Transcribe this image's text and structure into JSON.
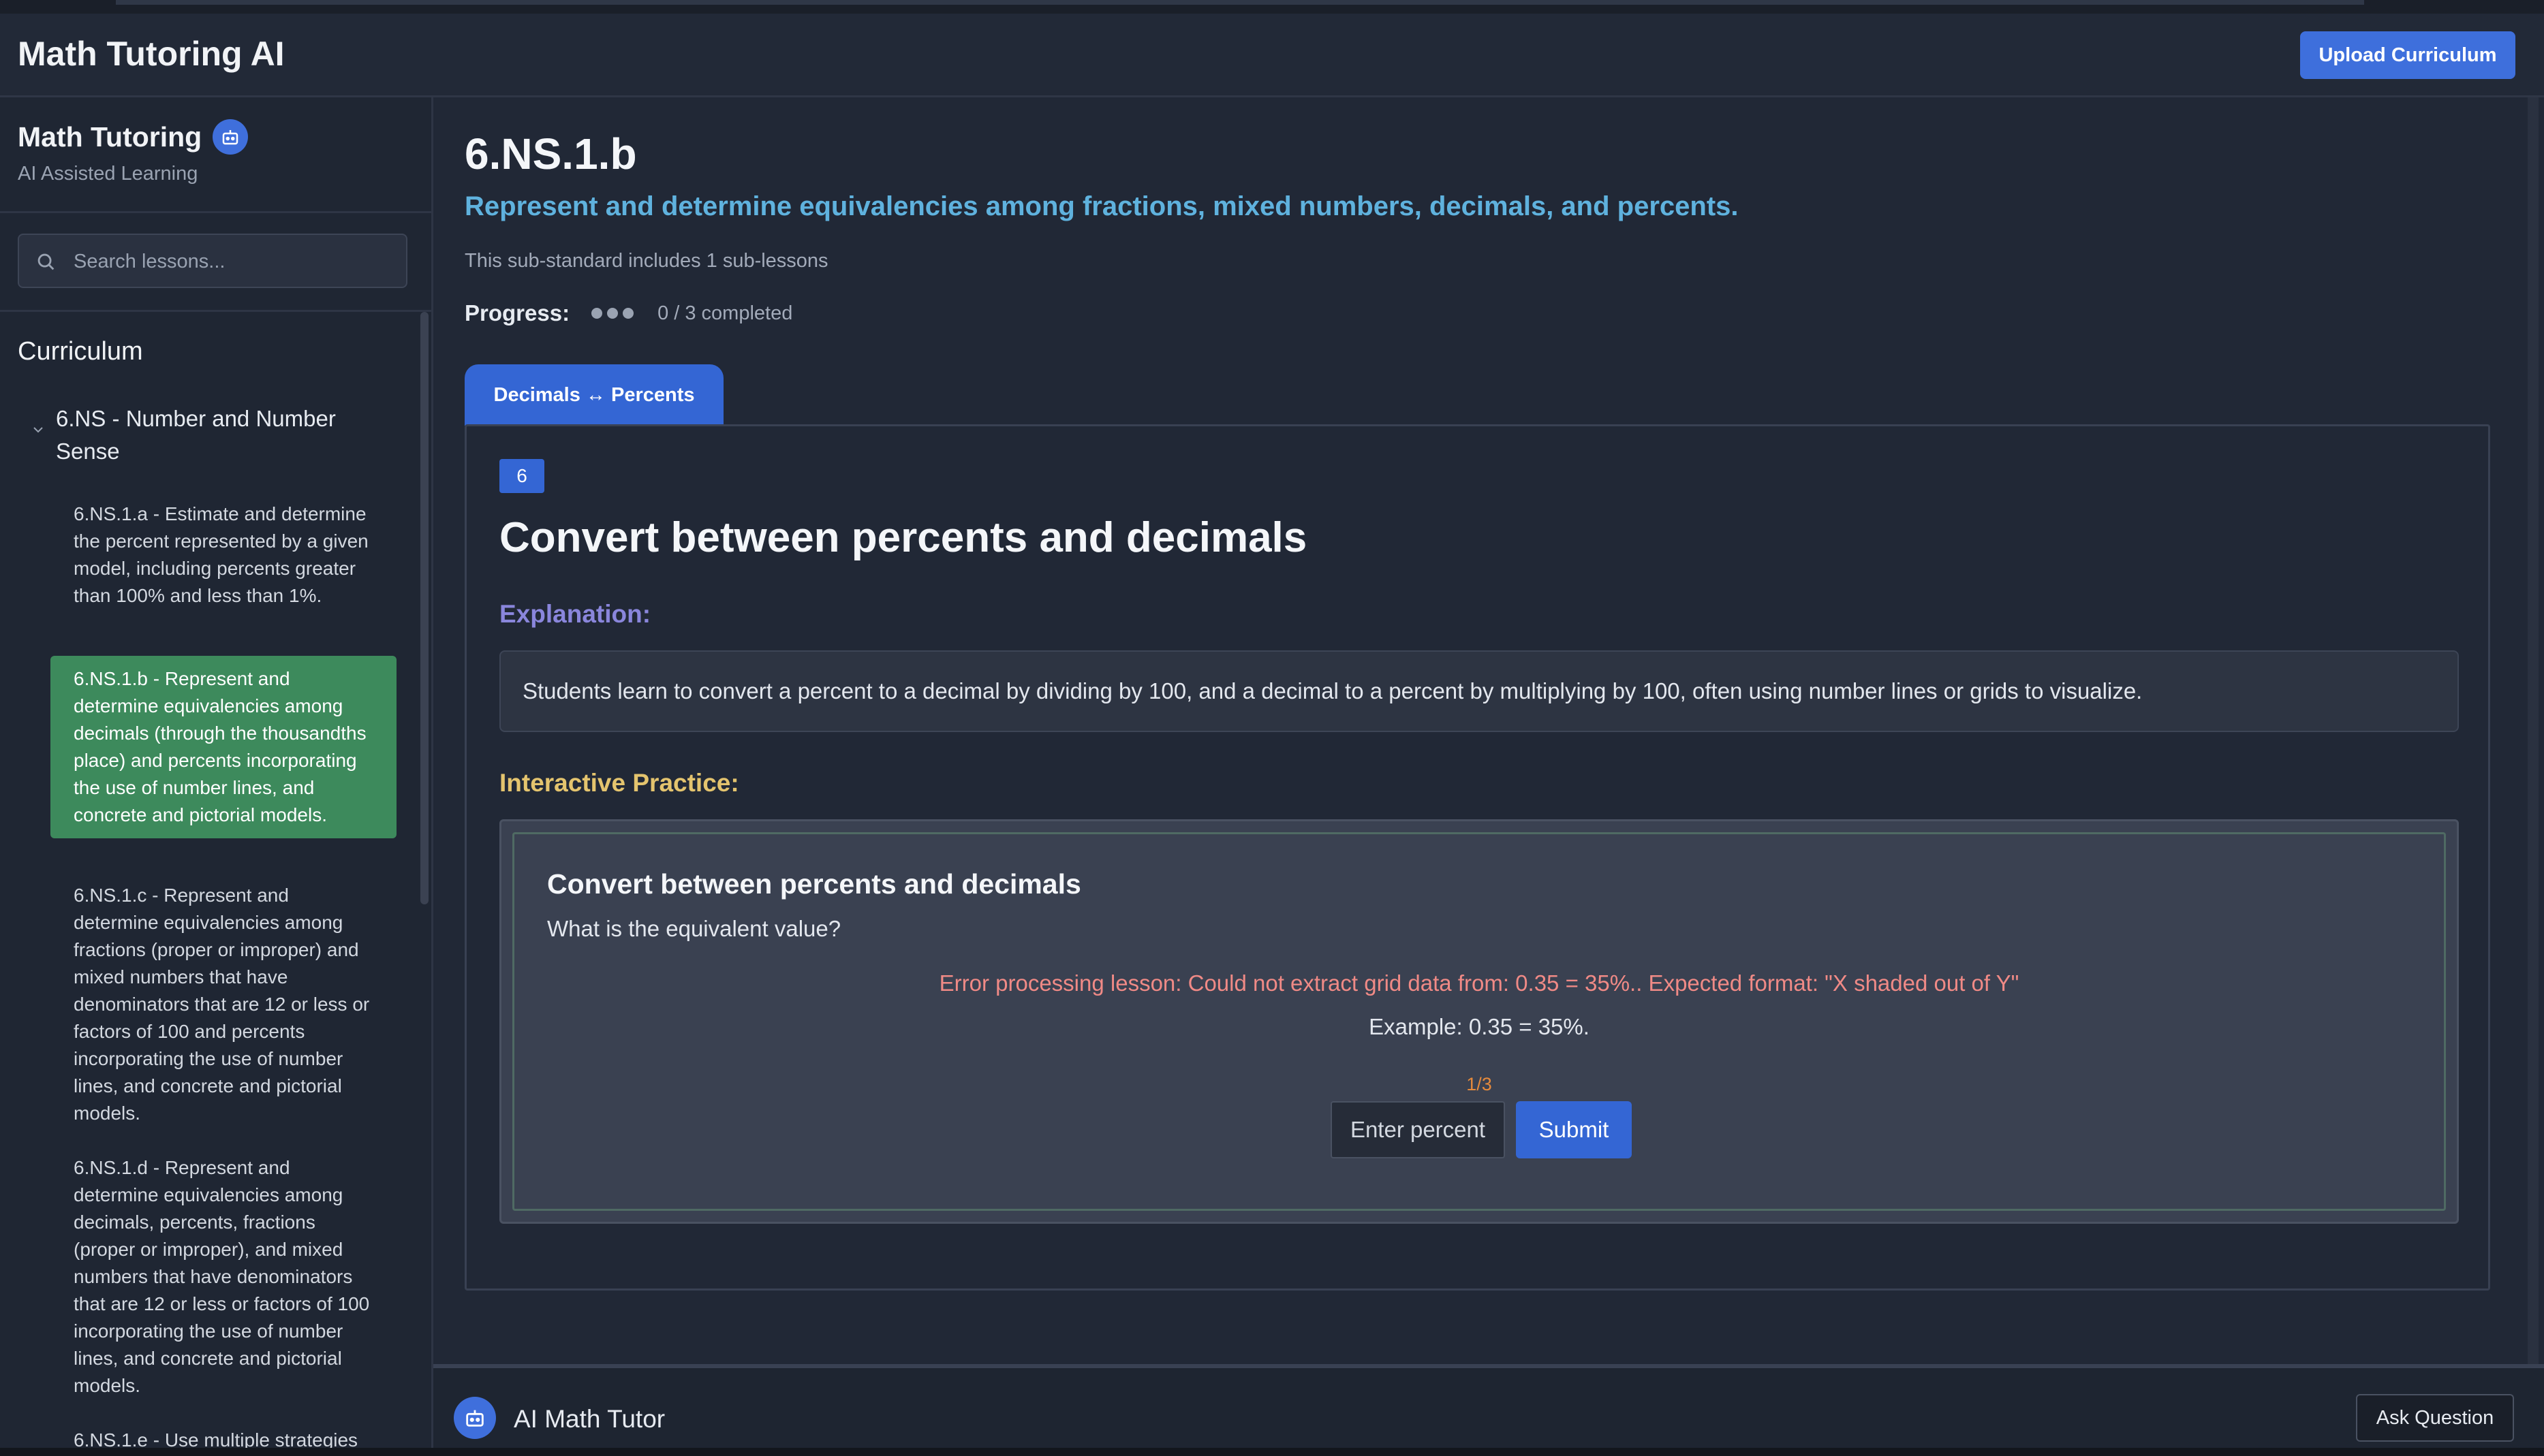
{
  "header": {
    "app_title": "Math Tutoring AI",
    "upload_label": "Upload Curriculum"
  },
  "sidebar": {
    "brand": "Math Tutoring",
    "subtitle": "AI Assisted Learning",
    "search_placeholder": "Search lessons...",
    "curriculum_title": "Curriculum",
    "group_label": "6.NS - Number and Number Sense",
    "lessons": [
      {
        "label": "6.NS.1.a - Estimate and determine the percent represented by a given model, including percents greater than 100% and less than 1%."
      },
      {
        "label": "6.NS.1.b - Represent and determine equivalencies among decimals (through the thousandths place) and percents incorporating the use of number lines, and concrete and pictorial models."
      },
      {
        "label": "6.NS.1.c - Represent and determine equivalencies among fractions (proper or improper) and mixed numbers that have denominators that are 12 or less or factors of 100 and percents incorporating the use of number lines, and concrete and pictorial models."
      },
      {
        "label": "6.NS.1.d - Represent and determine equivalencies among decimals, percents, fractions (proper or improper), and mixed numbers that have denominators that are 12 or less or factors of 100 incorporating the use of number lines, and concrete and pictorial models."
      },
      {
        "label": "6.NS.1.e - Use multiple strategies"
      }
    ]
  },
  "main": {
    "standard_code": "6.NS.1.b",
    "standard_desc": "Represent and determine equivalencies among fractions, mixed numbers, decimals, and percents.",
    "sub_info": "This sub-standard includes 1 sub-lessons",
    "progress_label": "Progress:",
    "progress_text": "0 / 3 completed",
    "progress_completed": 0,
    "progress_total": 3,
    "tab_label": "Decimals ↔ Percents",
    "grade": "6",
    "lesson_title": "Convert between percents and decimals",
    "explanation_heading": "Explanation:",
    "explanation_text": "Students learn to convert a percent to a decimal by dividing by 100, and a decimal to a percent by multiplying by 100, often using number lines or grids to visualize.",
    "practice_heading": "Interactive Practice:",
    "practice": {
      "title": "Convert between percents and decimals",
      "question": "What is the equivalent value?",
      "error": "Error processing lesson: Could not extract grid data from: 0.35 = 35%.. Expected format: \"X shaded out of Y\"",
      "example": "Example: 0.35 = 35%.",
      "counter": "1/3",
      "input_placeholder": "Enter percent",
      "submit_label": "Submit"
    }
  },
  "tutor": {
    "title": "AI Math Tutor",
    "ask_label": "Ask Question"
  },
  "colors": {
    "accent": "#3466d4",
    "active_lesson": "#3d8a5c",
    "standard_desc": "#5fb2de",
    "explanation_heading": "#8a86dc",
    "practice_heading": "#e4c46e",
    "error": "#f08a86"
  },
  "icons": {
    "bot": "robot-icon",
    "search": "search-icon",
    "chevron": "chevron-down-icon"
  }
}
